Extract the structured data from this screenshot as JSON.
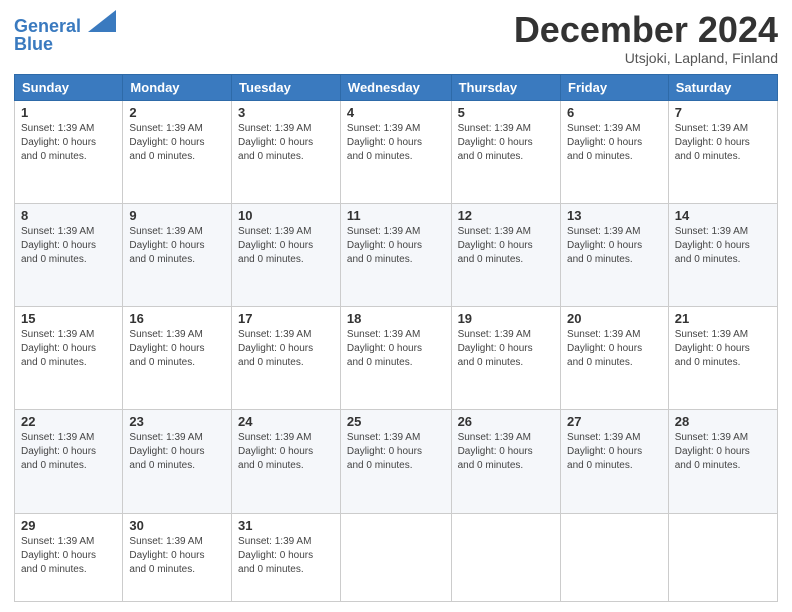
{
  "header": {
    "logo_line1": "General",
    "logo_line2": "Blue",
    "main_title": "December 2024",
    "subtitle": "Utsjoki, Lapland, Finland"
  },
  "days_of_week": [
    "Sunday",
    "Monday",
    "Tuesday",
    "Wednesday",
    "Thursday",
    "Friday",
    "Saturday"
  ],
  "cell_info": "Sunset: 1:39 AM\nDaylight: 0 hours and 0 minutes.",
  "weeks": [
    [
      {
        "day": "1",
        "info": "Sunset: 1:39 AM\nDaylight: 0 hours\nand 0 minutes."
      },
      {
        "day": "2",
        "info": "Sunset: 1:39 AM\nDaylight: 0 hours\nand 0 minutes."
      },
      {
        "day": "3",
        "info": "Sunset: 1:39 AM\nDaylight: 0 hours\nand 0 minutes."
      },
      {
        "day": "4",
        "info": "Sunset: 1:39 AM\nDaylight: 0 hours\nand 0 minutes."
      },
      {
        "day": "5",
        "info": "Sunset: 1:39 AM\nDaylight: 0 hours\nand 0 minutes."
      },
      {
        "day": "6",
        "info": "Sunset: 1:39 AM\nDaylight: 0 hours\nand 0 minutes."
      },
      {
        "day": "7",
        "info": "Sunset: 1:39 AM\nDaylight: 0 hours\nand 0 minutes."
      }
    ],
    [
      {
        "day": "8",
        "info": "Sunset: 1:39 AM\nDaylight: 0 hours\nand 0 minutes."
      },
      {
        "day": "9",
        "info": "Sunset: 1:39 AM\nDaylight: 0 hours\nand 0 minutes."
      },
      {
        "day": "10",
        "info": "Sunset: 1:39 AM\nDaylight: 0 hours\nand 0 minutes."
      },
      {
        "day": "11",
        "info": "Sunset: 1:39 AM\nDaylight: 0 hours\nand 0 minutes."
      },
      {
        "day": "12",
        "info": "Sunset: 1:39 AM\nDaylight: 0 hours\nand 0 minutes."
      },
      {
        "day": "13",
        "info": "Sunset: 1:39 AM\nDaylight: 0 hours\nand 0 minutes."
      },
      {
        "day": "14",
        "info": "Sunset: 1:39 AM\nDaylight: 0 hours\nand 0 minutes."
      }
    ],
    [
      {
        "day": "15",
        "info": "Sunset: 1:39 AM\nDaylight: 0 hours\nand 0 minutes."
      },
      {
        "day": "16",
        "info": "Sunset: 1:39 AM\nDaylight: 0 hours\nand 0 minutes."
      },
      {
        "day": "17",
        "info": "Sunset: 1:39 AM\nDaylight: 0 hours\nand 0 minutes."
      },
      {
        "day": "18",
        "info": "Sunset: 1:39 AM\nDaylight: 0 hours\nand 0 minutes."
      },
      {
        "day": "19",
        "info": "Sunset: 1:39 AM\nDaylight: 0 hours\nand 0 minutes."
      },
      {
        "day": "20",
        "info": "Sunset: 1:39 AM\nDaylight: 0 hours\nand 0 minutes."
      },
      {
        "day": "21",
        "info": "Sunset: 1:39 AM\nDaylight: 0 hours\nand 0 minutes."
      }
    ],
    [
      {
        "day": "22",
        "info": "Sunset: 1:39 AM\nDaylight: 0 hours\nand 0 minutes."
      },
      {
        "day": "23",
        "info": "Sunset: 1:39 AM\nDaylight: 0 hours\nand 0 minutes."
      },
      {
        "day": "24",
        "info": "Sunset: 1:39 AM\nDaylight: 0 hours\nand 0 minutes."
      },
      {
        "day": "25",
        "info": "Sunset: 1:39 AM\nDaylight: 0 hours\nand 0 minutes."
      },
      {
        "day": "26",
        "info": "Sunset: 1:39 AM\nDaylight: 0 hours\nand 0 minutes."
      },
      {
        "day": "27",
        "info": "Sunset: 1:39 AM\nDaylight: 0 hours\nand 0 minutes."
      },
      {
        "day": "28",
        "info": "Sunset: 1:39 AM\nDaylight: 0 hours\nand 0 minutes."
      }
    ],
    [
      {
        "day": "29",
        "info": "Sunset: 1:39 AM\nDaylight: 0 hours\nand 0 minutes."
      },
      {
        "day": "30",
        "info": "Sunset: 1:39 AM\nDaylight: 0 hours\nand 0 minutes."
      },
      {
        "day": "31",
        "info": "Sunset: 1:39 AM\nDaylight: 0 hours\nand 0 minutes."
      },
      {
        "day": "",
        "info": ""
      },
      {
        "day": "",
        "info": ""
      },
      {
        "day": "",
        "info": ""
      },
      {
        "day": "",
        "info": ""
      }
    ]
  ]
}
